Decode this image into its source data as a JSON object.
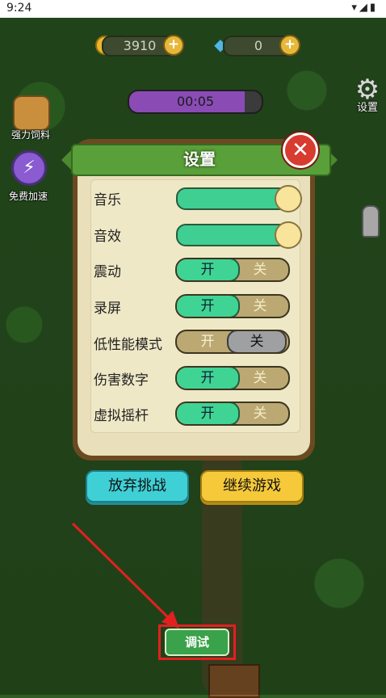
{
  "status_bar": {
    "time": "9:24",
    "icons": "▾◢▮"
  },
  "hud": {
    "coins": "3910",
    "gems": "0",
    "timer": "00:05",
    "timer_progress": 0.87,
    "settings_label": "设置",
    "feed_label": "强力饲料",
    "speed_label": "免费加速"
  },
  "settings_panel": {
    "title": "设置",
    "close_symbol": "✕",
    "rows": [
      {
        "label": "音乐",
        "type": "slider",
        "value": 1.0
      },
      {
        "label": "音效",
        "type": "slider",
        "value": 1.0
      },
      {
        "label": "震动",
        "type": "toggle",
        "on_label": "开",
        "off_label": "关",
        "state": "on"
      },
      {
        "label": "录屏",
        "type": "toggle",
        "on_label": "开",
        "off_label": "关",
        "state": "on"
      },
      {
        "label": "低性能模式",
        "type": "toggle",
        "on_label": "开",
        "off_label": "关",
        "state": "off"
      },
      {
        "label": "伤害数字",
        "type": "toggle",
        "on_label": "开",
        "off_label": "关",
        "state": "on"
      },
      {
        "label": "虚拟摇杆",
        "type": "toggle",
        "on_label": "开",
        "off_label": "关",
        "state": "on"
      }
    ]
  },
  "buttons": {
    "abandon": "放弃挑战",
    "continue": "继续游戏",
    "debug": "调试"
  },
  "colors": {
    "highlight": "#e22020",
    "toggle_on": "#3fd494",
    "slider_fill": "#3fcf92"
  }
}
